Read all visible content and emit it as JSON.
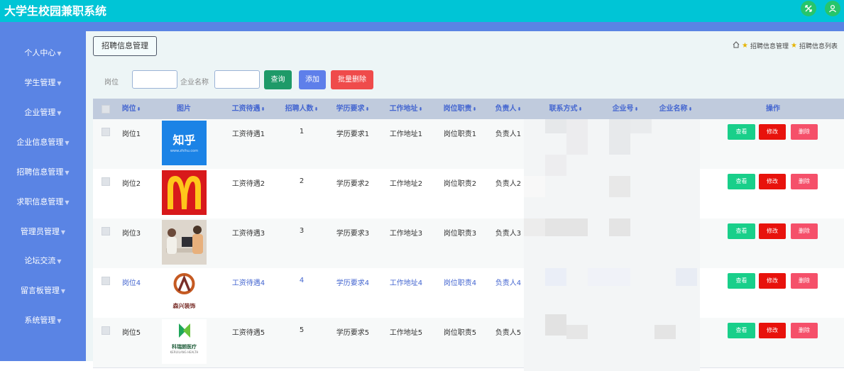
{
  "app": {
    "title": "大学生校园兼职系统"
  },
  "colors": {
    "header": "#00c5d6",
    "sidebar": "#5a84e4",
    "main_bg": "#edf5f6",
    "link_row": "#4466d0"
  },
  "sidebar": {
    "items": [
      {
        "label": "个人中心"
      },
      {
        "label": "学生管理"
      },
      {
        "label": "企业管理"
      },
      {
        "label": "企业信息管理"
      },
      {
        "label": "招聘信息管理"
      },
      {
        "label": "求职信息管理"
      },
      {
        "label": "管理员管理"
      },
      {
        "label": "论坛交流"
      },
      {
        "label": "留言板管理"
      },
      {
        "label": "系统管理"
      }
    ]
  },
  "page_tag": "招聘信息管理",
  "breadcrumb": {
    "level1": "招聘信息管理",
    "level2": "招聘信息列表"
  },
  "search": {
    "position_label": "岗位",
    "position_value": "",
    "company_label": "企业名称",
    "company_value": "",
    "query_btn": "查询",
    "add_btn": "添加",
    "batch_delete_btn": "批量删除"
  },
  "table": {
    "columns": [
      "岗位",
      "图片",
      "工资待遇",
      "招聘人数",
      "学历要求",
      "工作地址",
      "岗位职责",
      "负责人",
      "联系方式",
      "企业号",
      "企业名称",
      "操作"
    ],
    "rows": [
      {
        "post": "岗位1",
        "logo": "zhihu-logo",
        "logo_text": "知乎",
        "logo_sub": "www.zhihu.com",
        "salary": "工资待遇1",
        "count": "1",
        "edu": "学历要求1",
        "addr": "工作地址1",
        "duty": "岗位职责1",
        "owner": "负责人1"
      },
      {
        "post": "岗位2",
        "logo": "mcdonalds-logo",
        "logo_text": "",
        "logo_sub": "",
        "salary": "工资待遇2",
        "count": "2",
        "edu": "学历要求2",
        "addr": "工作地址2",
        "duty": "岗位职责2",
        "owner": "负责人2"
      },
      {
        "post": "岗位3",
        "logo": "office-photo",
        "logo_text": "",
        "logo_sub": "",
        "salary": "工资待遇3",
        "count": "3",
        "edu": "学历要求3",
        "addr": "工作地址3",
        "duty": "岗位职责3",
        "owner": "负责人3"
      },
      {
        "post": "岗位4",
        "logo": "decoration-logo",
        "logo_text": "森兴装饰",
        "logo_sub": "",
        "salary": "工资待遇4",
        "count": "4",
        "edu": "学历要求4",
        "addr": "工作地址4",
        "duty": "岗位职责4",
        "owner": "负责人4"
      },
      {
        "post": "岗位5",
        "logo": "health-logo",
        "logo_text": "科瑞朗医疗",
        "logo_sub": "KERUILANG HEALTH",
        "salary": "工资待遇5",
        "count": "5",
        "edu": "学历要求5",
        "addr": "工作地址5",
        "duty": "岗位职责5",
        "owner": "负责人5"
      }
    ],
    "actions": {
      "view": "查看",
      "edit": "修改",
      "delete": "删除"
    }
  }
}
